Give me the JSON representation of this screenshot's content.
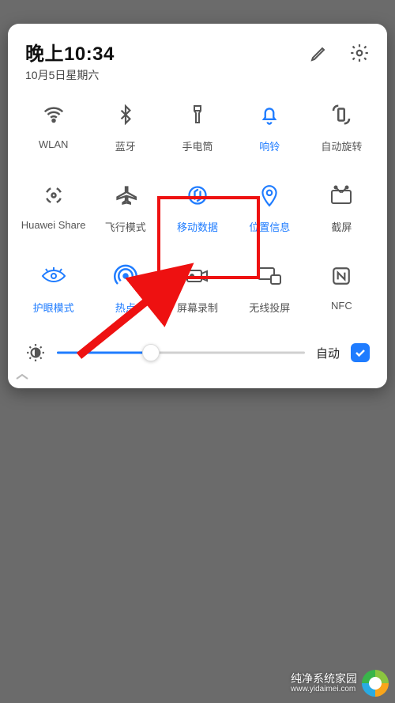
{
  "header": {
    "time": "晚上10:34",
    "date": "10月5日星期六"
  },
  "colors": {
    "accent": "#1f7cff",
    "inactive": "#555",
    "highlight": "#e11"
  },
  "tiles": [
    {
      "id": "wlan",
      "label": "WLAN",
      "icon": "wifi-icon",
      "active": false
    },
    {
      "id": "bluetooth",
      "label": "蓝牙",
      "icon": "bluetooth-icon",
      "active": false
    },
    {
      "id": "flashlight",
      "label": "手电筒",
      "icon": "flashlight-icon",
      "active": false
    },
    {
      "id": "ring",
      "label": "响铃",
      "icon": "bell-icon",
      "active": true
    },
    {
      "id": "rotate",
      "label": "自动旋转",
      "icon": "rotate-icon",
      "active": false
    },
    {
      "id": "huaweishare",
      "label": "Huawei Share",
      "icon": "share-icon",
      "active": false
    },
    {
      "id": "airplane",
      "label": "飞行模式",
      "icon": "airplane-icon",
      "active": false
    },
    {
      "id": "mobiledata",
      "label": "移动数据",
      "icon": "data-icon",
      "active": true,
      "highlighted": true
    },
    {
      "id": "location",
      "label": "位置信息",
      "icon": "location-icon",
      "active": true
    },
    {
      "id": "screenshot",
      "label": "截屏",
      "icon": "screenshot-icon",
      "active": false
    },
    {
      "id": "eyecomfort",
      "label": "护眼模式",
      "icon": "eye-icon",
      "active": true
    },
    {
      "id": "hotspot",
      "label": "热点",
      "icon": "hotspot-icon",
      "active": true
    },
    {
      "id": "record",
      "label": "屏幕录制",
      "icon": "record-icon",
      "active": false
    },
    {
      "id": "cast",
      "label": "无线投屏",
      "icon": "cast-icon",
      "active": false
    },
    {
      "id": "nfc",
      "label": "NFC",
      "icon": "nfc-icon",
      "active": false
    }
  ],
  "brightness": {
    "value_pct": 38,
    "auto_label": "自动",
    "auto_checked": true
  },
  "watermark": {
    "title": "纯净系统家园",
    "url": "www.yidaimei.com"
  }
}
